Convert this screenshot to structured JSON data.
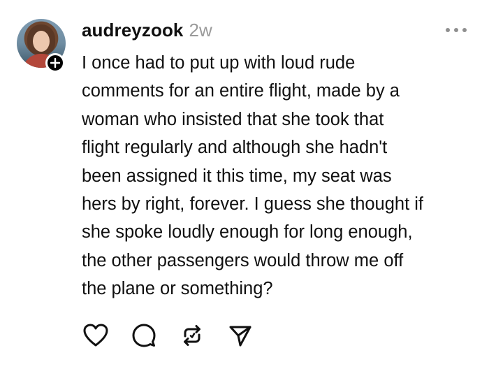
{
  "post": {
    "username": "audreyzook",
    "timestamp": "2w",
    "text": "I once had to put up with loud rude\ncomments for an entire flight, made by a\nwoman who insisted that she took that\nflight regularly and although she hadn't\nbeen assigned it this time, my seat was\nhers by right, forever. I guess she thought if\nshe spoke loudly enough for long enough,\nthe other passengers would throw me off\nthe plane or something?",
    "avatar_icon": "profile-photo",
    "follow_icon": "plus-icon",
    "more_icon": "more-horizontal-icon"
  },
  "actions": [
    {
      "name": "like",
      "icon": "heart-icon"
    },
    {
      "name": "reply",
      "icon": "comment-icon"
    },
    {
      "name": "repost",
      "icon": "repost-icon"
    },
    {
      "name": "share",
      "icon": "send-icon"
    }
  ],
  "colors": {
    "text": "#101010",
    "muted": "#9a9a9a",
    "background": "#ffffff"
  }
}
